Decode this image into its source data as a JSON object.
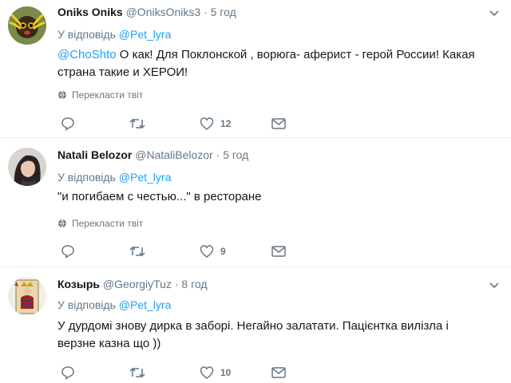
{
  "tweets": [
    {
      "name": "Oniks Oniks",
      "handle": "@OniksOniks3",
      "sep": "·",
      "time": "5 год",
      "reply_prefix": "У відповідь",
      "reply_to": "@Pet_lyra",
      "mention": "@ChoShto",
      "text": " О как!  Для Поклонской , ворюга- аферист -   герой России! Какая страна такие и ХЕРОИ!",
      "translate": "Перекласти твіт",
      "likes": "12"
    },
    {
      "name": "Natali Belozor",
      "handle": "@NataliBelozor",
      "sep": "·",
      "time": "5 год",
      "reply_prefix": "У відповідь",
      "reply_to": "@Pet_lyra",
      "text": "\"и погибаем с честью...\" в ресторане",
      "translate": "Перекласти твіт",
      "likes": "9"
    },
    {
      "name": "Козырь",
      "handle": "@GeorgiyTuz",
      "sep": "·",
      "time": "8 год",
      "reply_prefix": "У відповідь",
      "reply_to": "@Pet_lyra",
      "text": "У дурдомі знову дирка в заборі. Негайно залатати. Пацієнтка вилізла і верзне казна що ))",
      "likes": "10"
    }
  ],
  "icons": [
    "reply-icon",
    "retweet-icon",
    "like-icon",
    "message-icon",
    "globe-icon",
    "chevron-down-icon"
  ],
  "colors": {
    "link": "#1da1f2",
    "secondary_text": "#657786",
    "divider": "#e6ecf0"
  }
}
